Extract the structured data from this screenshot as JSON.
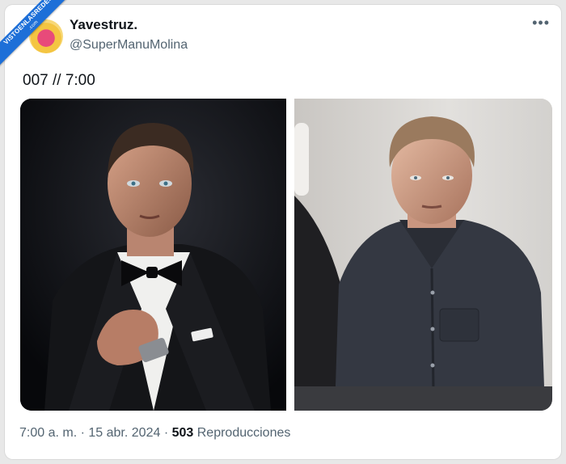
{
  "tweet": {
    "display_name": "Yavestruz.",
    "handle": "@SuperManuMolina",
    "more_icon": "more-horizontal-icon",
    "text": "007 // 7:00",
    "time": "7:00 a. m.",
    "separator": "·",
    "date": "15 abr. 2024",
    "view_count": "503",
    "views_label": "Reproducciones"
  },
  "watermark": {
    "line1": "VISTOENLASREDES",
    "line2": ".com"
  },
  "colors": {
    "ribbon": "#1d6fd8",
    "text_primary": "#0f1419",
    "text_secondary": "#536471"
  }
}
